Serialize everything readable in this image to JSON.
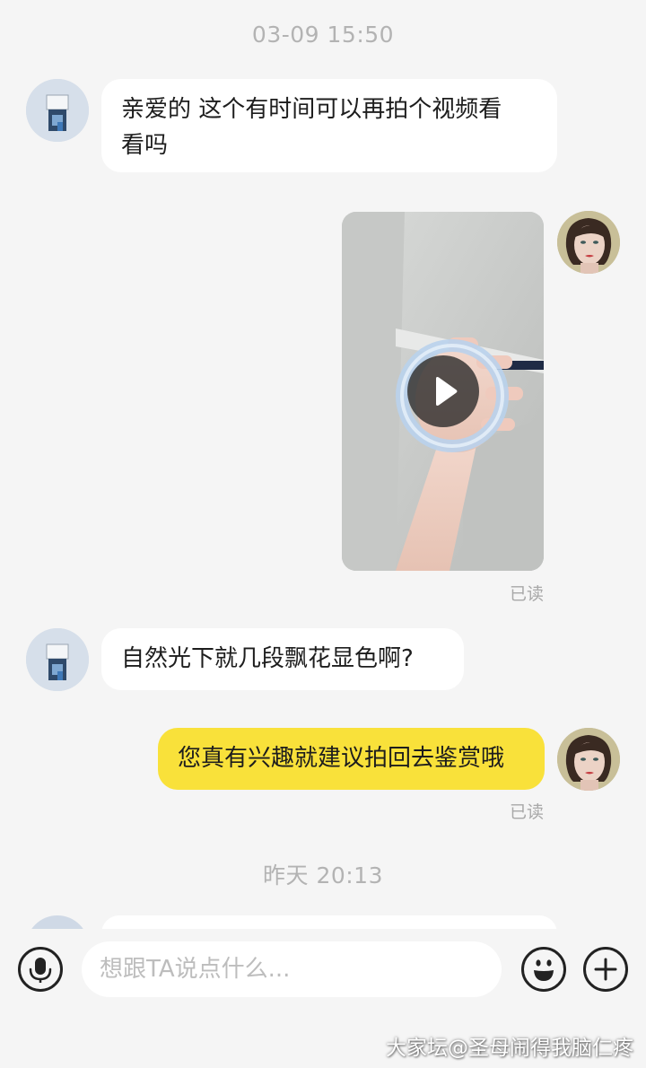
{
  "chat": {
    "timestamp_1": "03-09 15:50",
    "timestamp_2": "昨天 20:13",
    "messages": [
      {
        "side": "in",
        "text_line1": "亲爱的 这个有时间可以再拍个视频看",
        "text_line2": "看吗"
      },
      {
        "side": "out",
        "type": "video",
        "read": "已读"
      },
      {
        "side": "in",
        "text": "自然光下就几段飘花显色啊?"
      },
      {
        "side": "out",
        "text": "您真有兴趣就建议拍回去鉴赏哦",
        "read": "已读"
      }
    ]
  },
  "input": {
    "placeholder": "想跟TA说点什么..."
  },
  "watermark": "大家坛@圣母闹得我脑仁疼",
  "colors": {
    "background": "#f5f5f5",
    "bubble_in": "#ffffff",
    "bubble_out": "#f9e13a",
    "timestamp": "#b3b3b3"
  },
  "icons": [
    "microphone-icon",
    "play-icon",
    "emoji-icon",
    "plus-icon"
  ]
}
